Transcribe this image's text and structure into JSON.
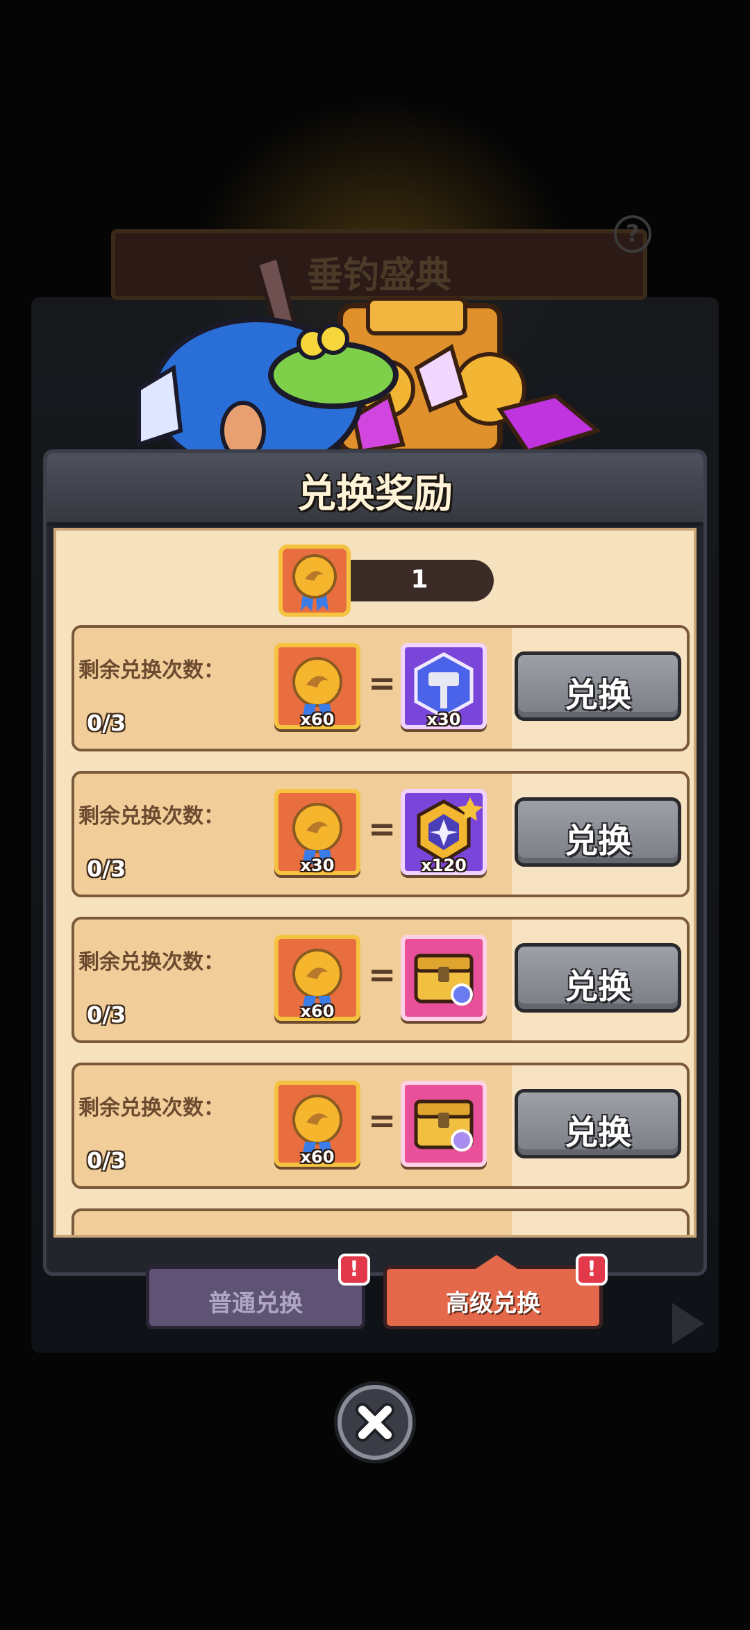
{
  "background": {
    "event_title": "垂钓盛典",
    "help_icon_text": "?"
  },
  "panel": {
    "title": "兑换奖励"
  },
  "balance": {
    "icon": "medal-icon",
    "count": "1"
  },
  "exchange_rows": [
    {
      "label": "剩余兑换次数：",
      "remaining": "0/3",
      "cost_qty": "x60",
      "equals": "=",
      "reward_icon": "hammer-shield-icon",
      "reward_qty": "x30",
      "button": "兑换"
    },
    {
      "label": "剩余兑换次数：",
      "remaining": "0/3",
      "cost_qty": "x30",
      "equals": "=",
      "reward_icon": "star-emblem-icon",
      "reward_qty": "x120",
      "button": "兑换"
    },
    {
      "label": "剩余兑换次数：",
      "remaining": "0/3",
      "cost_qty": "x60",
      "equals": "=",
      "reward_icon": "treasure-chest-icon",
      "reward_qty": "",
      "button": "兑换"
    },
    {
      "label": "剩余兑换次数：",
      "remaining": "0/3",
      "cost_qty": "x60",
      "equals": "=",
      "reward_icon": "treasure-chest-icon",
      "reward_qty": "",
      "button": "兑换"
    }
  ],
  "tabs": [
    {
      "label": "普通兑换",
      "badge": "!",
      "active": false
    },
    {
      "label": "高级兑换",
      "badge": "!",
      "active": true
    }
  ],
  "colors": {
    "panel_bg": "#f6e2bf",
    "row_bg": "#f0cd99",
    "button_gray": "#8c9096",
    "tab_active": "#e4694a",
    "tab_inactive": "#5e5374"
  }
}
